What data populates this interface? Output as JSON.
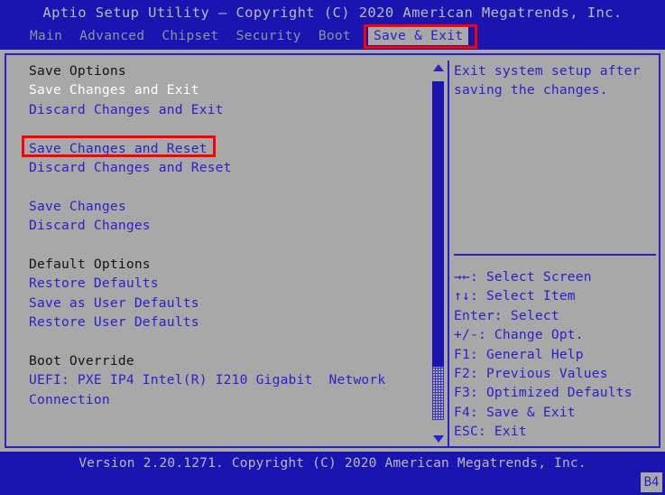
{
  "header": {
    "title": "Aptio Setup Utility – Copyright (C) 2020 American Megatrends, Inc.",
    "menu": [
      {
        "label": "Main",
        "active": false
      },
      {
        "label": "Advanced",
        "active": false
      },
      {
        "label": "Chipset",
        "active": false
      },
      {
        "label": "Security",
        "active": false
      },
      {
        "label": "Boot",
        "active": false
      },
      {
        "label": "Save & Exit",
        "active": true
      }
    ]
  },
  "main": {
    "options": [
      {
        "label": "Save Options",
        "kind": "section"
      },
      {
        "label": "Save Changes and Exit",
        "kind": "selected"
      },
      {
        "label": "Discard Changes and Exit",
        "kind": "item"
      },
      {
        "label": " ",
        "kind": "blank"
      },
      {
        "label": "Save Changes and Reset",
        "kind": "item"
      },
      {
        "label": "Discard Changes and Reset",
        "kind": "item"
      },
      {
        "label": " ",
        "kind": "blank"
      },
      {
        "label": "Save Changes",
        "kind": "item"
      },
      {
        "label": "Discard Changes",
        "kind": "item"
      },
      {
        "label": " ",
        "kind": "blank"
      },
      {
        "label": "Default Options",
        "kind": "section"
      },
      {
        "label": "Restore Defaults",
        "kind": "item"
      },
      {
        "label": "Save as User Defaults",
        "kind": "item"
      },
      {
        "label": "Restore User Defaults",
        "kind": "item"
      },
      {
        "label": " ",
        "kind": "blank"
      },
      {
        "label": "Boot Override",
        "kind": "section"
      },
      {
        "label": "UEFI: PXE IP4 Intel(R) I210 Gigabit  Network",
        "kind": "item"
      },
      {
        "label": "Connection",
        "kind": "item"
      }
    ],
    "scrollbar": {
      "up_arrow": "scroll-up-arrow",
      "down_arrow": "scroll-down-arrow"
    }
  },
  "help": {
    "lines": [
      "Exit system setup after",
      "saving the changes."
    ],
    "legend": [
      "→←: Select Screen",
      "↑↓: Select Item",
      "Enter: Select",
      "+/-: Change Opt.",
      "F1: General Help",
      "F2: Previous Values",
      "F3: Optimized Defaults",
      "F4: Save & Exit",
      "ESC: Exit"
    ]
  },
  "footer": {
    "version": "Version 2.20.1271. Copyright (C) 2020 American Megatrends, Inc.",
    "badge": "B4"
  },
  "colors": {
    "background": "#1a14b0",
    "panel": "#a8a8a8",
    "text_blue": "#2a22c8",
    "text_gray": "#b8bcc4",
    "section_black": "#15150f",
    "selected_white": "#ffffff",
    "annotation_red": "#ff0000"
  }
}
